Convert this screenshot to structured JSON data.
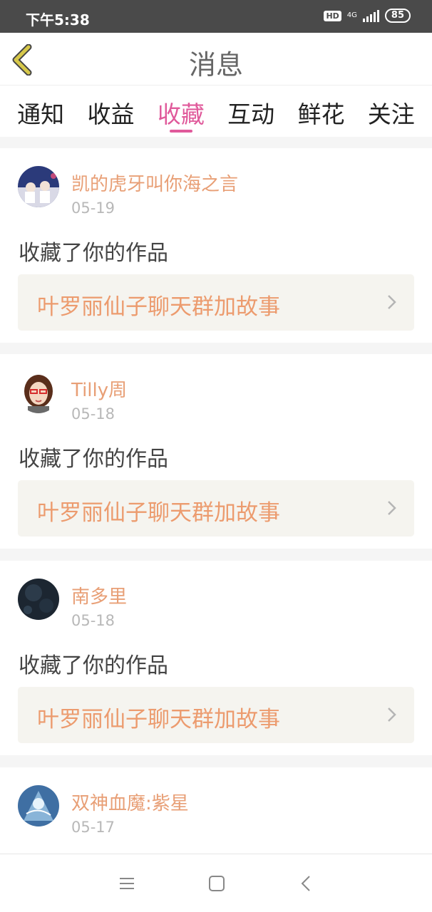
{
  "status_bar": {
    "time": "下午5:38",
    "hd": "HD",
    "network": "4G",
    "battery": "85"
  },
  "header": {
    "title": "消息",
    "back_icon": "chevron-left-icon"
  },
  "tabs": [
    {
      "label": "通知",
      "active": false
    },
    {
      "label": "收益",
      "active": false
    },
    {
      "label": "收藏",
      "active": true
    },
    {
      "label": "互动",
      "active": false
    },
    {
      "label": "鲜花",
      "active": false
    },
    {
      "label": "关注",
      "active": false
    }
  ],
  "messages": [
    {
      "username": "凯的虎牙叫你海之言",
      "date": "05-19",
      "action": "收藏了你的作品",
      "work_title": "叶罗丽仙子聊天群加故事"
    },
    {
      "username": "Tilly周",
      "date": "05-18",
      "action": "收藏了你的作品",
      "work_title": "叶罗丽仙子聊天群加故事"
    },
    {
      "username": "南多里",
      "date": "05-18",
      "action": "收藏了你的作品",
      "work_title": "叶罗丽仙子聊天群加故事"
    },
    {
      "username": "双神血魔:紫星",
      "date": "05-17"
    }
  ],
  "colors": {
    "accent": "#e05a9b",
    "username": "#e89f76",
    "work_title": "#ec9b6e",
    "back_icon": "#d7c84a"
  },
  "nav_bar": {
    "menu_icon": "menu-icon",
    "home_icon": "home-square-icon",
    "back_icon": "back-triangle-icon"
  }
}
